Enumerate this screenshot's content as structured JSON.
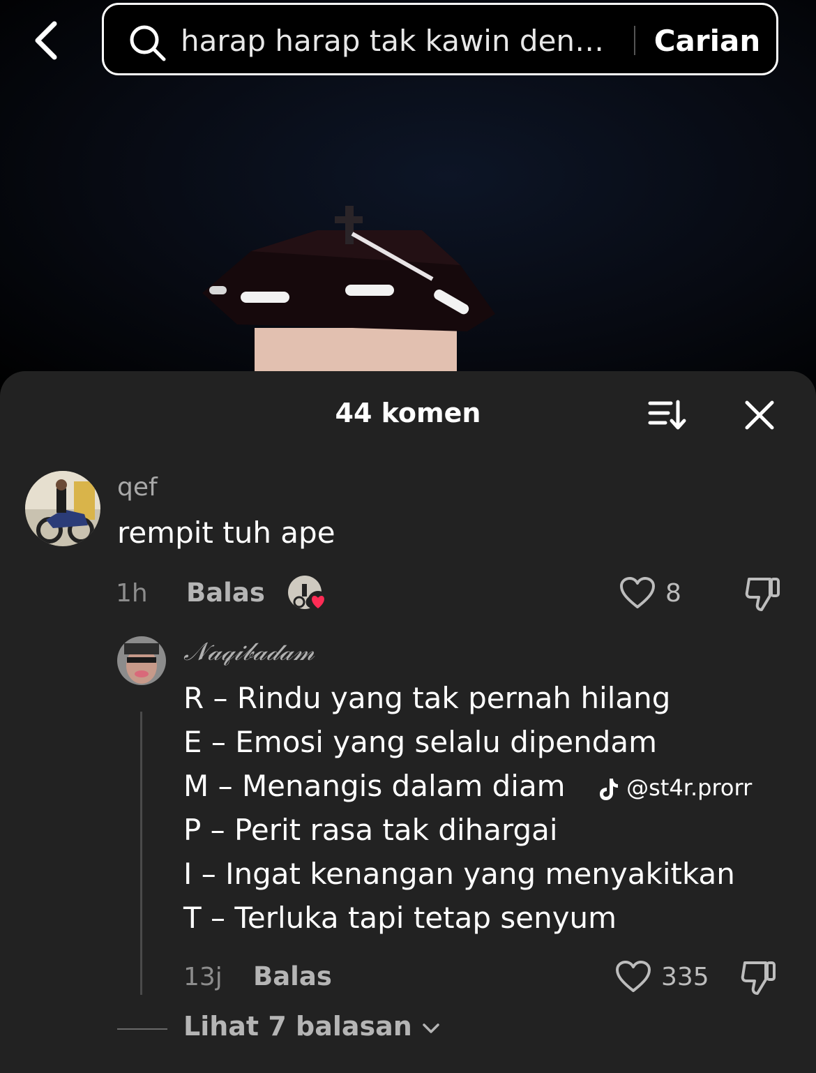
{
  "search": {
    "query": "harap harap tak kawin deng...",
    "submit_label": "Carian"
  },
  "comments_sheet": {
    "title": "44 komen"
  },
  "comment": {
    "username": "qef",
    "text": "rempit tuh ape",
    "time": "1h",
    "reply_label": "Balas",
    "likes": "8"
  },
  "reply": {
    "username": "𝒩𝒶𝓆𝒾𝒷𝒶𝒹𝒶𝓂",
    "lines": [
      "R – Rindu yang tak pernah hilang",
      "E – Emosi yang selalu dipendam",
      "M – Menangis dalam diam",
      "P – Perit rasa tak dihargai",
      "I – Ingat kenangan yang menyakitkan",
      "T – Terluka tapi tetap senyum"
    ],
    "time": "13j",
    "reply_label": "Balas",
    "likes": "335"
  },
  "view_more_replies": "Lihat 7 balasan",
  "watermark": "@st4r.prorr"
}
